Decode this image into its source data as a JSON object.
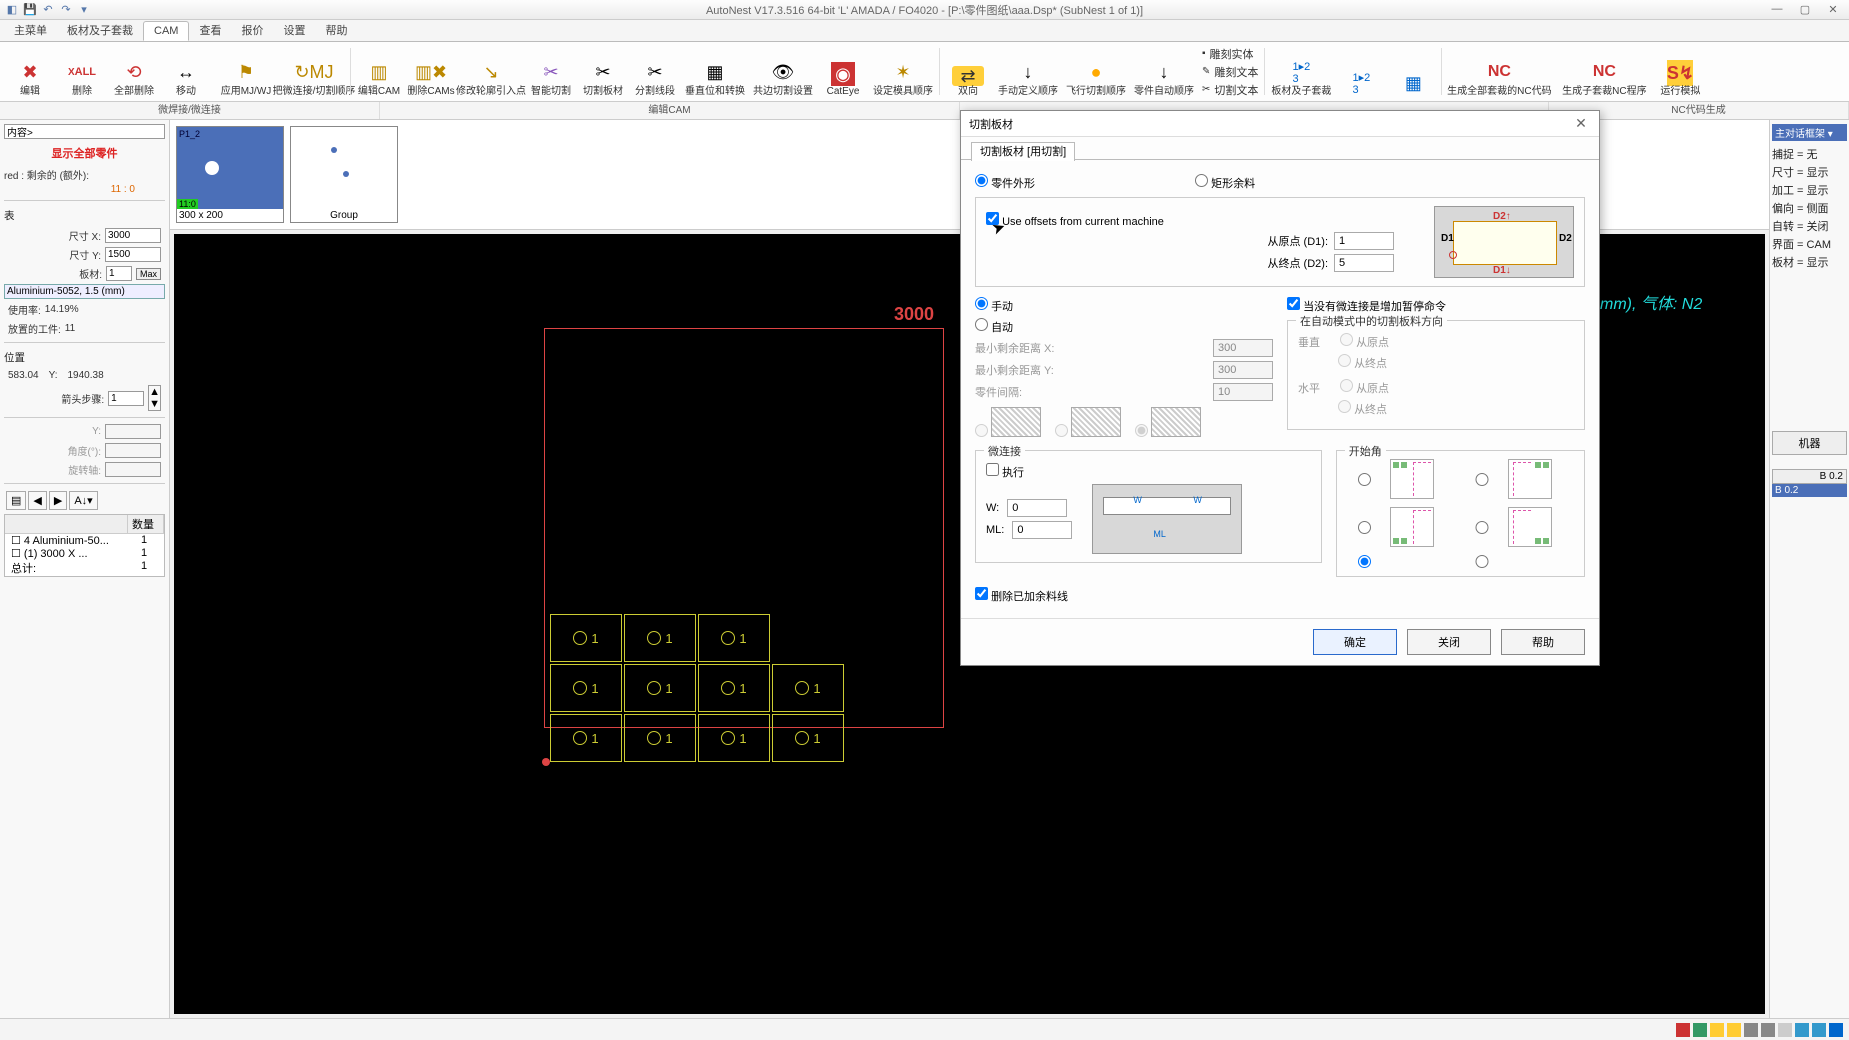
{
  "title_bar": {
    "app_title": "AutoNest V17.3.516 64-bit 'L' AMADA / FO4020      - [P:\\零件图纸\\aaa.Dsp* (SubNest 1 of 1)]"
  },
  "menu": {
    "tabs": [
      "主菜单",
      "板材及子套裁",
      "CAM",
      "查看",
      "报价",
      "设置",
      "帮助"
    ],
    "active": 2
  },
  "ribbon": {
    "buttons": [
      {
        "label": "编辑",
        "icon": "✖",
        "color": "#c33"
      },
      {
        "label": "删除",
        "icon": "XALL",
        "color": "#c33"
      },
      {
        "label": "全部删除",
        "icon": "⟲",
        "color": "#c33"
      },
      {
        "label": "移动",
        "icon": "↔",
        "color": "#666"
      },
      {
        "label": "应用MJ/WJ",
        "icon": "⚙",
        "color": "#b80"
      },
      {
        "label": "把微连接/切割顺序",
        "icon": "↻",
        "color": "#b80"
      },
      {
        "label": "编辑CAM",
        "icon": "▥",
        "color": "#b80"
      },
      {
        "label": "删除CAMs",
        "icon": "▥✖",
        "color": "#b80"
      },
      {
        "label": "修改轮廓引入点",
        "icon": "↘",
        "color": "#b80"
      },
      {
        "label": "智能切割",
        "icon": "✂",
        "color": "#85b"
      },
      {
        "label": "切割板材",
        "icon": "✂",
        "color": "#666"
      },
      {
        "label": "分割线段",
        "icon": "✂",
        "color": "#666"
      },
      {
        "label": "垂直位和转换",
        "icon": "▦",
        "color": "#666"
      },
      {
        "label": "共边切割设置",
        "icon": "👁",
        "color": "#666"
      },
      {
        "label": "CatEye",
        "icon": "◉",
        "color": "#c33"
      },
      {
        "label": "设定模具顺序",
        "icon": "✶",
        "color": "#b80"
      },
      {
        "label": "双向",
        "icon": "⇄",
        "color": "#fa0",
        "bg": "#ffd"
      },
      {
        "label": "手动定义顺序",
        "icon": "↓",
        "color": "#333"
      },
      {
        "label": "飞行切割顺序",
        "icon": "●",
        "color": "#fa0"
      },
      {
        "label": "零件自动顺序",
        "icon": "↓",
        "color": "#333"
      },
      {
        "label": "板材及子套裁",
        "icon": "1▸2",
        "color": "#06c"
      },
      {
        "label": "",
        "icon": "1▸2",
        "color": "#06c"
      },
      {
        "label": "",
        "icon": "▦",
        "color": "#06c"
      },
      {
        "label": "生成全部套裁的NC代码",
        "icon": "NC",
        "color": "#c33"
      },
      {
        "label": "生成子套裁NC程序",
        "icon": "NC",
        "color": "#c33"
      },
      {
        "label": "运行模拟",
        "icon": "S↯",
        "color": "#fa0"
      }
    ],
    "engrave_text": "雕刻文本",
    "cut_text": "切割文本",
    "engrave_solid": "雕刻实体"
  },
  "group_labels": {
    "g1": "微焊接/微连接",
    "g2": "编辑CAM",
    "g3": "NC代码生成"
  },
  "left": {
    "content_label": "内容>",
    "show_all": "显示全部零件",
    "red_line": "red : 剩余的 (额外):",
    "red_count": "11 : 0",
    "table_label": "表",
    "sizeX_label": "尺寸 X:",
    "sizeX": "3000",
    "sizeY_label": "尺寸 Y:",
    "sizeY": "1500",
    "sheet_label": "板材:",
    "sheet_val": "1",
    "maxbtn": "Max",
    "material": "Aluminium-5052, 1.5 (mm)",
    "usage_label": "使用率:",
    "usage": "14.19%",
    "placed_label": "放置的工件:",
    "placed": "11",
    "pos_label": "位置",
    "posX": "583.04",
    "posY_label": "Y:",
    "posY": "1940.38",
    "arrow_label": "箭头步骤:",
    "arrow_val": "1",
    "y2_label": "Y:",
    "y2_val": "",
    "angle_label": "角度(°):",
    "angle_val": "",
    "rot_label": "旋转轴:",
    "rot_val": "",
    "tree_header_qty": "数量",
    "tree": [
      {
        "name": "☐ 4  Aluminium-50...",
        "qty": "1"
      },
      {
        "name": "  ☐ (1) 3000 X ...",
        "qty": "1"
      },
      {
        "name": "总计:",
        "qty": "1"
      }
    ]
  },
  "thumbs": {
    "t1_label": "P1_2",
    "t1_green": "11:0",
    "t1_foot": "300 x 200",
    "t2_foot": "Group"
  },
  "canvas": {
    "dim_top": "3000",
    "cyan_text": "mm), 气体: N2"
  },
  "right": {
    "combo": "主对话框架 ▾",
    "lines": [
      "捕捉 = 无",
      "尺寸 = 显示",
      "加工 = 显示",
      "偏向 = 侧面",
      "自转 = 关闭",
      "界面 = CAM",
      "板材 = 显示"
    ],
    "machine_btn": "机器",
    "b_header": "B 0.2",
    "b_sel": "B 0.2"
  },
  "dialog": {
    "title": "切割板材",
    "tab": "切割板材 [用切割]",
    "opt_part": "零件外形",
    "opt_rect": "矩形余料",
    "use_offsets": "Use offsets from current machine",
    "d1_label": "从原点 (D1):",
    "d1": "1",
    "d2_label": "从终点 (D2):",
    "d2": "5",
    "diag_d1": "D1",
    "diag_d2": "D2",
    "diag_d2t": "D2↑",
    "diag_d1b": "D1↓",
    "manual": "手动",
    "auto": "自动",
    "pause_check": "当没有微连接是增加暂停命令",
    "minX_label": "最小剩余距离 X:",
    "minX": "300",
    "minY_label": "最小剩余距离 Y:",
    "minY": "300",
    "gap_label": "零件间隔:",
    "gap": "10",
    "dir_title": "在自动模式中的切割板料方向",
    "vert": "垂直",
    "horiz": "水平",
    "from_origin": "从原点",
    "from_end": "从终点",
    "mj_title": "微连接",
    "corner_title": "开始角",
    "mj_exec": "执行",
    "mj_w": "W:",
    "mj_w_val": "0",
    "mj_ml": "ML:",
    "mj_ml_val": "0",
    "del_check": "删除已加余料线",
    "ok": "确定",
    "close": "关闭",
    "help": "帮助"
  }
}
